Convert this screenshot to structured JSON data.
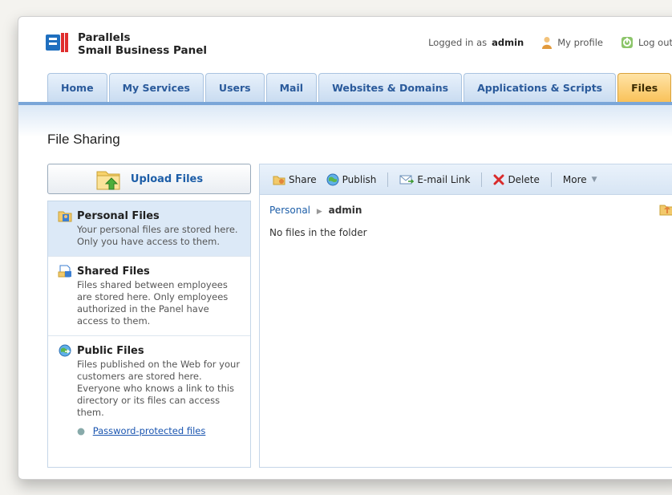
{
  "brand": {
    "line1": "Parallels",
    "line2": "Small Business Panel"
  },
  "topnav": {
    "logged_prefix": "Logged in as",
    "username": "admin",
    "profile_label": "My profile",
    "logout_label": "Log out"
  },
  "tabs": [
    {
      "label": "Home"
    },
    {
      "label": "My Services"
    },
    {
      "label": "Users"
    },
    {
      "label": "Mail"
    },
    {
      "label": "Websites & Domains"
    },
    {
      "label": "Applications & Scripts"
    },
    {
      "label": "Files",
      "active": true
    }
  ],
  "page_title": "File Sharing",
  "upload_label": "Upload Files",
  "sections": [
    {
      "title": "Personal Files",
      "desc": "Your personal files are stored here. Only you have access to them.",
      "icon": "personal-folder-icon"
    },
    {
      "title": "Shared Files",
      "desc": "Files shared between employees are stored here. Only employees authorized in the Panel have access to them.",
      "icon": "shared-folder-icon"
    },
    {
      "title": "Public Files",
      "desc": "Files published on the Web for your customers are stored here. Everyone who knows a link to this directory or its files can access them.",
      "icon": "public-globe-icon",
      "link": "Password-protected files"
    }
  ],
  "toolbar": {
    "share": "Share",
    "publish": "Publish",
    "email_link": "E-mail Link",
    "delete": "Delete",
    "more": "More"
  },
  "breadcrumb": {
    "root": "Personal",
    "current": "admin"
  },
  "empty_message": "No files in the folder",
  "colors": {
    "accent_tab": "#f9c25a",
    "link": "#1a55b0",
    "panel_border": "#c5d6e8"
  }
}
